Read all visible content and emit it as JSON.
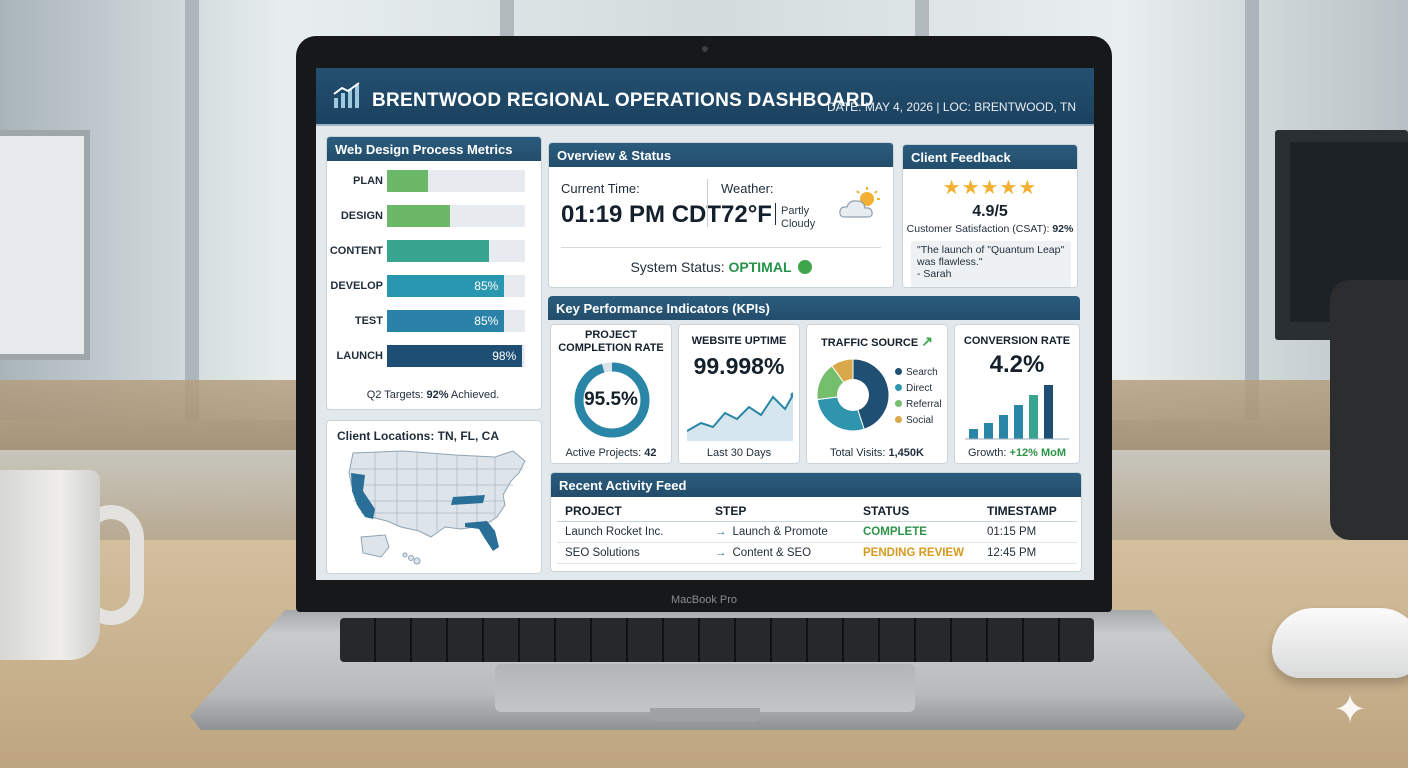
{
  "scene": {
    "laptop_model": "MacBook Pro"
  },
  "dashboard": {
    "title": "BRENTWOOD REGIONAL OPERATIONS DASHBOARD",
    "meta": "DATE: MAY 4, 2026  |  LOC: BRENTWOOD, TN",
    "logo_icon": "bar-chart-icon"
  },
  "process_metrics": {
    "title": "Web Design Process Metrics",
    "stages": [
      {
        "label": "PLAN",
        "fraction": 0.3,
        "pct_text": "",
        "color": "#6cb869"
      },
      {
        "label": "DESIGN",
        "fraction": 0.46,
        "pct_text": "",
        "color": "#6cb869"
      },
      {
        "label": "CONTENT",
        "fraction": 0.74,
        "pct_text": "",
        "color": "#3aa58f"
      },
      {
        "label": "DEVELOP",
        "fraction": 0.85,
        "pct_text": "85%",
        "color": "#2a97b0"
      },
      {
        "label": "TEST",
        "fraction": 0.85,
        "pct_text": "85%",
        "color": "#2a82a8"
      },
      {
        "label": "LAUNCH",
        "fraction": 0.98,
        "pct_text": "98%",
        "color": "#1e4e73"
      }
    ],
    "footer_prefix": "Q2 Targets: ",
    "footer_value": "92%",
    "footer_suffix": " Achieved."
  },
  "client_locations": {
    "title": "Client Locations: TN, FL, CA",
    "highlight_color": "#2a6f98",
    "highlighted_states": [
      "CA",
      "TN",
      "FL"
    ]
  },
  "overview": {
    "title": "Overview & Status",
    "time_label": "Current Time:",
    "time_value": "01:19 PM CDT",
    "weather_label": "Weather:",
    "temp_value": "72°F",
    "condition_line1": "Partly",
    "condition_line2": "Cloudy",
    "weather_icon": "partly-cloudy-icon",
    "status_label": "System Status: ",
    "status_value": "OPTIMAL",
    "status_color": "#3ea54d"
  },
  "feedback": {
    "title": "Client Feedback",
    "stars_text": "★★★★★",
    "rating": "4.9/5",
    "csat_label": "Customer Satisfaction (CSAT): ",
    "csat_value": "92%",
    "quote": "\"The launch of \"Quantum Leap\" was flawless.\"",
    "quote_author": "- Sarah"
  },
  "kpis": {
    "title": "Key Performance Indicators (KPIs)",
    "completion": {
      "title_line1": "PROJECT",
      "title_line2": "COMPLETION RATE",
      "value": "95.5%",
      "fraction": 0.955,
      "foot_label": "Active Projects: ",
      "foot_value": "42"
    },
    "uptime": {
      "title": "WEBSITE UPTIME",
      "value": "99.998%",
      "foot": "Last 30 Days"
    },
    "traffic": {
      "title": "TRAFFIC SOURCE",
      "trend_icon": "trend-up-arrow-icon",
      "sources": [
        {
          "name": "Search",
          "share": 0.45,
          "color": "#1f4f73"
        },
        {
          "name": "Direct",
          "share": 0.28,
          "color": "#2f94ae"
        },
        {
          "name": "Referral",
          "share": 0.17,
          "color": "#74be6c"
        },
        {
          "name": "Social",
          "share": 0.1,
          "color": "#d9a84a"
        }
      ],
      "foot_label": "Total Visits: ",
      "foot_value": "1,450K"
    },
    "conversion": {
      "title": "CONVERSION RATE",
      "value": "4.2%",
      "foot_label": "Growth: ",
      "foot_value": "+12% MoM"
    }
  },
  "activity": {
    "title": "Recent Activity Feed",
    "columns": [
      "PROJECT",
      "STEP",
      "STATUS",
      "TIMESTAMP"
    ],
    "rows": [
      {
        "project": "Launch Rocket Inc.",
        "step": "Launch & Promote",
        "status": "COMPLETE",
        "status_kind": "complete",
        "timestamp": "01:15 PM"
      },
      {
        "project": "SEO Solutions",
        "step": "Content & SEO",
        "status": "PENDING REVIEW",
        "status_kind": "pending",
        "timestamp": "12:45 PM"
      }
    ]
  }
}
